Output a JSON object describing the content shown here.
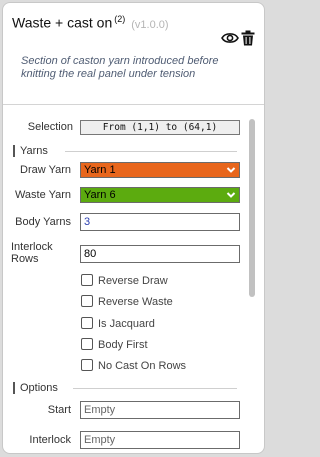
{
  "node": {
    "title": "Waste + cast on",
    "count": "(2)",
    "version": "(v1.0.0)",
    "description": "Section of caston yarn introduced before knitting the real panel under tension"
  },
  "icons": {
    "visibility": "eye-icon",
    "delete": "trash-icon"
  },
  "fields": {
    "selection_label": "Selection",
    "selection_value": "From (1,1) to (64,1)",
    "yarns_section": "Yarns",
    "draw_yarn_label": "Draw Yarn",
    "draw_yarn_value": "Yarn 1",
    "draw_yarn_color": "#e8661c",
    "waste_yarn_label": "Waste Yarn",
    "waste_yarn_value": "Yarn 6",
    "waste_yarn_color": "#5cab0f",
    "body_yarns_label": "Body Yarns",
    "body_yarns_value": "3",
    "interlock_rows_label_1": "Interlock",
    "interlock_rows_label_2": "Rows",
    "interlock_rows_value": "80",
    "checkboxes": [
      {
        "label": "Reverse Draw",
        "checked": false
      },
      {
        "label": "Reverse Waste",
        "checked": false
      },
      {
        "label": "Is Jacquard",
        "checked": false
      },
      {
        "label": "Body First",
        "checked": false
      },
      {
        "label": "No Cast On Rows",
        "checked": false
      }
    ],
    "options_section": "Options",
    "start_label": "Start",
    "start_value": "Empty",
    "interlock_label": "Interlock",
    "interlock_value": "Empty"
  }
}
